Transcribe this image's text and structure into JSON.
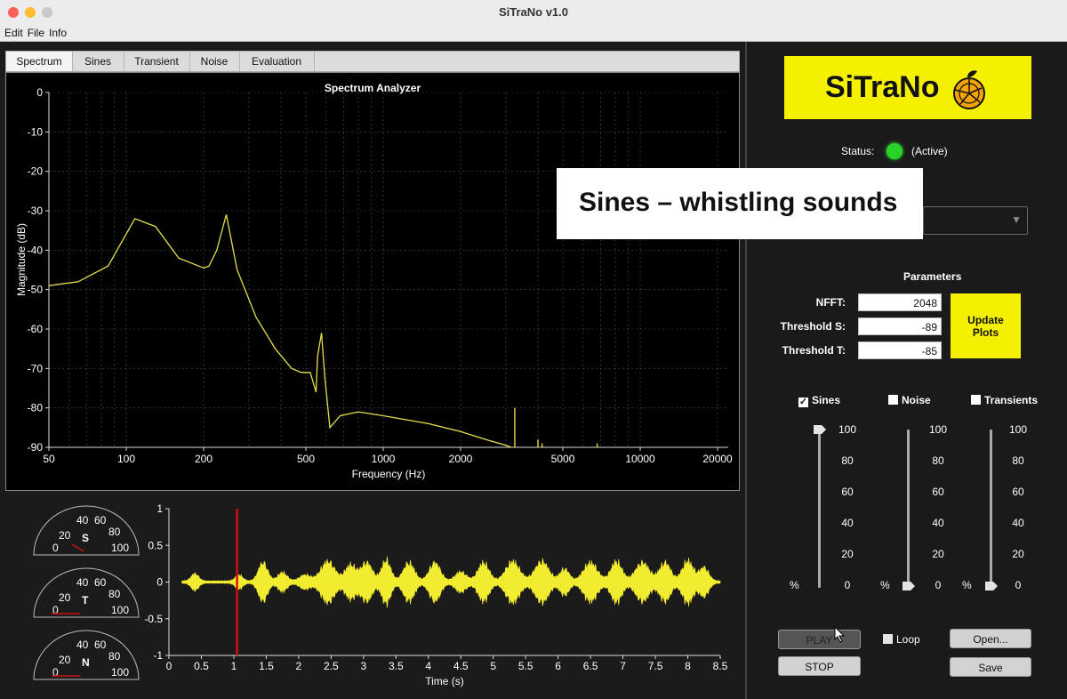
{
  "window": {
    "title": "SiTraNo v1.0"
  },
  "menu": [
    "Edit",
    "File",
    "Info"
  ],
  "tabs": [
    "Spectrum",
    "Sines",
    "Transient",
    "Noise",
    "Evaluation"
  ],
  "spectrum": {
    "title": "Spectrum Analyzer",
    "xlabel": "Frequency (Hz)",
    "ylabel": "Magnitude (dB)",
    "xticks": [
      "50",
      "100",
      "200",
      "500",
      "1000",
      "2000",
      "5000",
      "10000",
      "20000"
    ],
    "yticks": [
      "0",
      "-10",
      "-20",
      "-30",
      "-40",
      "-50",
      "-60",
      "-70",
      "-80",
      "-90"
    ]
  },
  "meters": [
    {
      "letter": "S",
      "labels": [
        "20",
        "40",
        "60",
        "80",
        "0",
        "100"
      ]
    },
    {
      "letter": "T",
      "labels": [
        "20",
        "40",
        "60",
        "80",
        "0",
        "100"
      ]
    },
    {
      "letter": "N",
      "labels": [
        "20",
        "40",
        "60",
        "80",
        "0",
        "100"
      ]
    }
  ],
  "waveform": {
    "xlabel": "Time (s)",
    "xticks": [
      "0",
      "0.5",
      "1",
      "1.5",
      "2",
      "2.5",
      "3",
      "3.5",
      "4",
      "4.5",
      "5",
      "5.5",
      "6",
      "6.5",
      "7",
      "7.5",
      "8",
      "8.5"
    ],
    "yticks": [
      "1",
      "0.5",
      "0",
      "-0.5",
      "-1"
    ]
  },
  "chart_data": [
    {
      "type": "line",
      "title": "Spectrum Analyzer",
      "xlabel": "Frequency (Hz)",
      "ylabel": "Magnitude (dB)",
      "xscale": "log",
      "xlim": [
        50,
        22000
      ],
      "ylim": [
        -90,
        0
      ],
      "grid": true,
      "series": [
        {
          "color": "#e6e04a",
          "x": [
            50,
            65,
            85,
            108,
            130,
            160,
            200,
            210,
            225,
            245,
            270,
            320,
            380,
            440,
            480,
            520,
            548,
            555,
            575,
            592,
            620,
            680,
            800,
            1000,
            1500,
            2000,
            2500,
            3000,
            3150
          ],
          "y": [
            -49,
            -48,
            -44,
            -32,
            -34,
            -42,
            -44.5,
            -44,
            -40,
            -31,
            -45,
            -57,
            -65,
            -70,
            -71,
            -71,
            -76,
            -67,
            -61,
            -72,
            -85,
            -82,
            -81,
            -82,
            -84,
            -86,
            -88,
            -89.5,
            -90
          ]
        }
      ]
    },
    {
      "type": "line",
      "xlabel": "Time (s)",
      "xlim": [
        0,
        8.5
      ],
      "ylim": [
        -1,
        1
      ],
      "series": [
        {
          "color": "#f2ec30",
          "x": [
            0.2,
            8.5
          ],
          "y": [
            0,
            0
          ]
        }
      ],
      "marker_time": 1.05
    }
  ],
  "logo": {
    "text": "SiTraNo"
  },
  "status": {
    "label": "Status:",
    "value": "(Active)"
  },
  "overlay": {
    "text": "Sines – whistling sounds"
  },
  "params": {
    "title": "Parameters",
    "nfft_label": "NFFT:",
    "nfft_value": "2048",
    "ths_label": "Threshold S:",
    "ths_value": "-89",
    "tht_label": "Threshold T:",
    "tht_value": "-85",
    "update_label": "Update Plots"
  },
  "channels": [
    {
      "label": "Sines",
      "checked": true,
      "value": 100
    },
    {
      "label": "Noise",
      "checked": false,
      "value": 0
    },
    {
      "label": "Transients",
      "checked": false,
      "value": 0
    }
  ],
  "slider_ticks": [
    "100",
    "80",
    "60",
    "40",
    "20",
    "0"
  ],
  "slider_unit": "%",
  "controls": {
    "play": "PLAY",
    "stop": "STOP",
    "loop": "Loop",
    "open": "Open...",
    "save": "Save"
  },
  "colors": {
    "accent": "#f5f000",
    "status_active": "#28d228",
    "trace": "#e6e04a",
    "cursor": "#d01010"
  }
}
